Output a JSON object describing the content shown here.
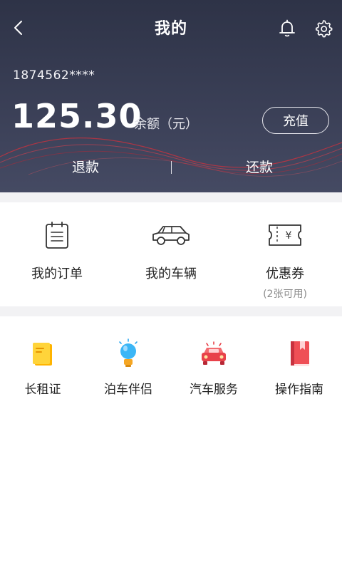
{
  "header": {
    "title": "我的",
    "back_icon": "chevron-left-icon",
    "bell_icon": "bell-icon",
    "settings_icon": "gear-icon"
  },
  "account": {
    "phone": "1874562****",
    "balance": "125.30",
    "balance_label": "余额（元）",
    "recharge_label": "充值",
    "refund_label": "退款",
    "repay_label": "还款"
  },
  "quick_actions": [
    {
      "label": "我的订单",
      "icon": "order-icon"
    },
    {
      "label": "我的车辆",
      "icon": "car-icon"
    },
    {
      "label": "优惠券",
      "sublabel": "(2张可用)",
      "icon": "coupon-icon"
    }
  ],
  "services": [
    {
      "label": "长租证",
      "icon": "permit-icon"
    },
    {
      "label": "泊车伴侣",
      "icon": "bulb-icon"
    },
    {
      "label": "汽车服务",
      "icon": "car-service-icon"
    },
    {
      "label": "操作指南",
      "icon": "guide-book-icon"
    }
  ],
  "colors": {
    "header_bg": "#3a3f56",
    "accent_red": "#e8424a",
    "yellow": "#ffc61a",
    "blue": "#2ea8f0"
  }
}
